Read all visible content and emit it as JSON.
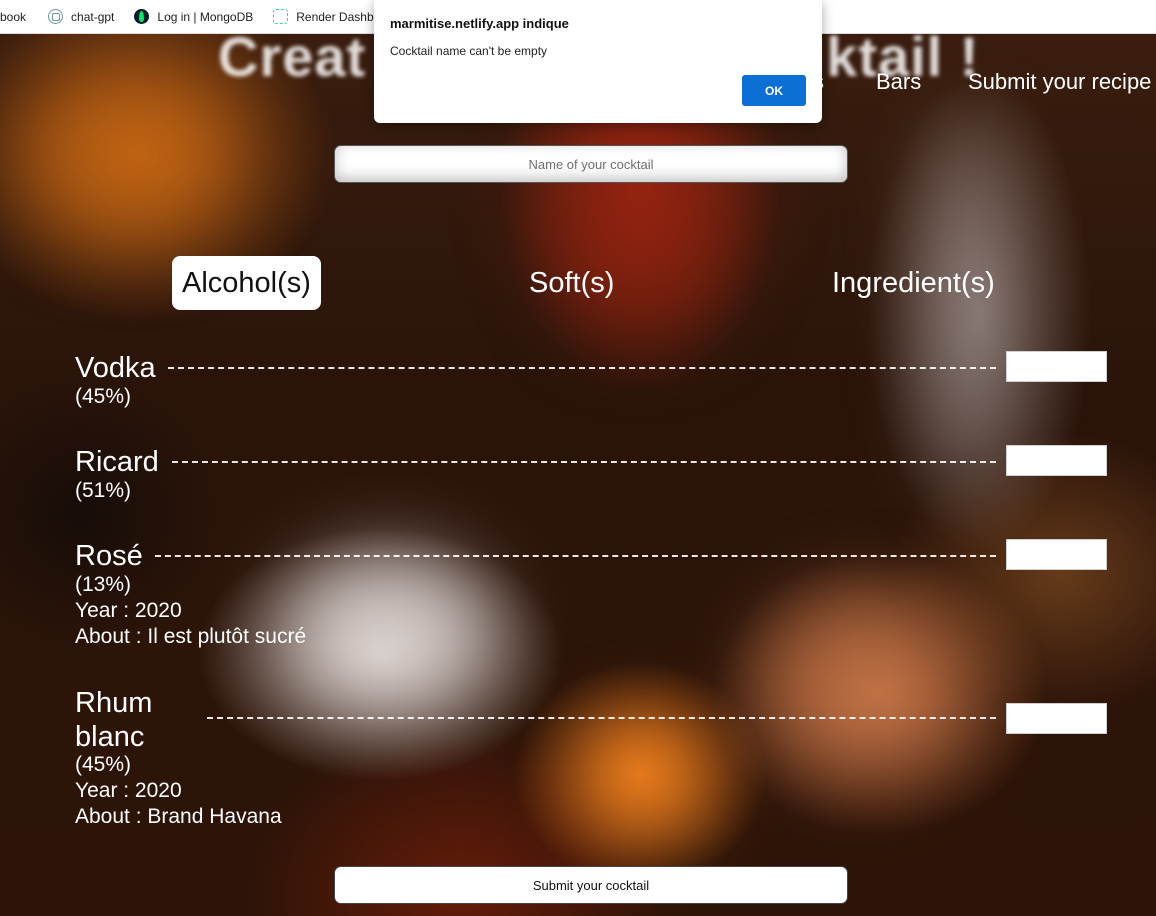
{
  "browser": {
    "bookmarks": [
      {
        "label": "book",
        "icon": "none"
      },
      {
        "label": "chat-gpt",
        "icon": "chatgpt-icon"
      },
      {
        "label": "Log in | MongoDB",
        "icon": "mongodb-leaf-icon"
      },
      {
        "label": "Render Dashboa",
        "icon": "render-icon"
      }
    ]
  },
  "dialog": {
    "title": "marmitise.netlify.app indique",
    "message": "Cocktail name can't be empty",
    "ok_label": "OK",
    "ok_color": "#0b6fd6"
  },
  "header": {
    "title_partial_left": "Creat",
    "title_partial_right": "ktail !",
    "nav": {
      "hidden_item_tail": "s",
      "bars": "Bars",
      "submit_recipe": "Submit your recipe"
    }
  },
  "form": {
    "name_placeholder": "Name of your cocktail",
    "tabs": [
      {
        "label": "Alcohol(s)",
        "active": true
      },
      {
        "label": "Soft(s)",
        "active": false
      },
      {
        "label": "Ingredient(s)",
        "active": false
      }
    ],
    "items": [
      {
        "name": "Vodka",
        "degree": "(45%)"
      },
      {
        "name": "Ricard",
        "degree": "(51%)"
      },
      {
        "name": "Rosé",
        "degree": "(13%)",
        "year": "Year : 2020",
        "about": "About : Il est plutôt sucré"
      },
      {
        "name_line1": "Rhum",
        "name_line2": "blanc",
        "degree": "(45%)",
        "year": "Year : 2020",
        "about": "About : Brand Havana"
      }
    ],
    "submit_label": "Submit your cocktail"
  }
}
